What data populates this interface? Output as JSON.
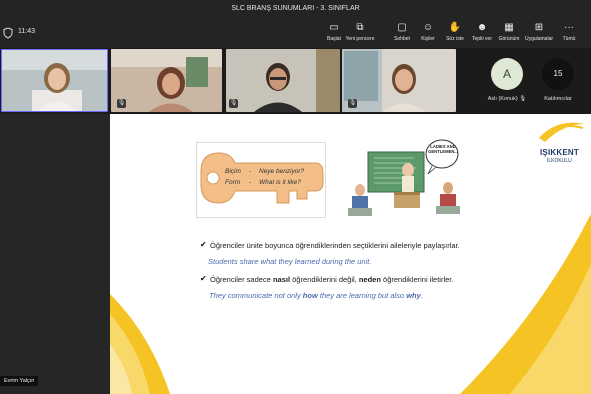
{
  "window": {
    "title": "SLC BRANŞ SUNUMLARI - 3. SINIFLAR"
  },
  "toolbar": {
    "timer": "11:43",
    "buttons": [
      {
        "label": "Başlat",
        "icon": "start-icon"
      },
      {
        "label": "Yeni pencere",
        "icon": "new-window-icon"
      },
      {
        "label": "Sohbet",
        "icon": "chat-icon"
      },
      {
        "label": "Kişiler",
        "icon": "people-icon"
      },
      {
        "label": "Söz iste",
        "icon": "raise-hand-icon"
      },
      {
        "label": "Tepki ver",
        "icon": "reaction-icon"
      },
      {
        "label": "Görünüm",
        "icon": "view-icon"
      },
      {
        "label": "Uygulamalar",
        "icon": "apps-icon"
      },
      {
        "label": "Tümü",
        "icon": "more-icon"
      }
    ],
    "end_icon": "end-call-icon"
  },
  "participants": {
    "guest": {
      "initial": "A",
      "name": "Aslı (Konuk)"
    },
    "count": {
      "value": "15",
      "label": "Katılımcılar"
    }
  },
  "presenter": {
    "name": "Evrim Yalçın"
  },
  "slide": {
    "logo": {
      "name": "IŞIKKENT",
      "sub": "İLKOKULU"
    },
    "key": {
      "line1_label": "Biçim",
      "line1_text": "Neye benziyor?",
      "line2_label": "Form",
      "line2_text": "What is it like?"
    },
    "cartoon": {
      "bubble": "LADIES AND GENTLEMEN..."
    },
    "points": [
      {
        "tr": "Öğrenciler ünite boyunca öğrendiklerinden seçtiklerini aileleriyle paylaşırlar.",
        "en": "Students share what they learned during the unit."
      },
      {
        "tr_a": "Öğrenciler sadece ",
        "tr_b": "nasıl",
        "tr_c": " öğrendiklerini değil, ",
        "tr_d": "neden",
        "tr_e": " öğrendiklerini  iletirler.",
        "en_a": "They communicate not only ",
        "en_b": "how",
        "en_c": " they are learning but also ",
        "en_d": "why",
        "en_e": "."
      }
    ]
  },
  "colors": {
    "accent": "#f6c324",
    "key_fill": "#f3be88",
    "brand_blue": "#1f3b6b",
    "translation": "#4a6bb0"
  }
}
